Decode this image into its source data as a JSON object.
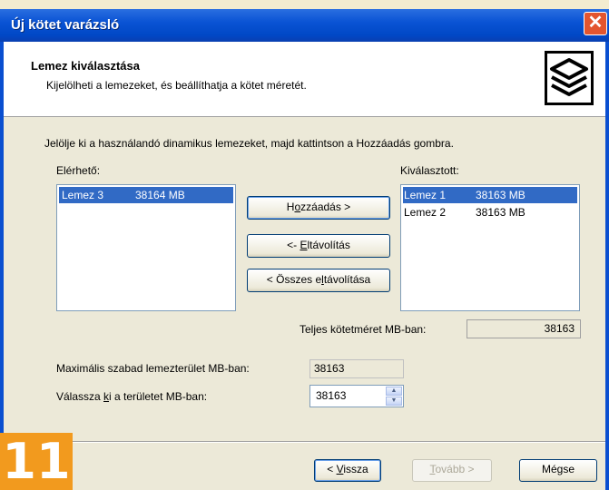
{
  "window": {
    "title": "Új kötet varázsló",
    "close_glyph": "✕"
  },
  "header": {
    "title": "Lemez kiválasztása",
    "subtitle": "Kijelölheti a lemezeket, és beállíthatja a kötet méretét.",
    "icon": "disks-stack-icon"
  },
  "instruction": "Jelölje ki a használandó dinamikus lemezeket, majd kattintson a Hozzáadás gombra.",
  "available": {
    "label": "Elérhető:",
    "items": [
      {
        "name": "Lemez 3",
        "size": "38164 MB",
        "selected": true
      }
    ]
  },
  "selected": {
    "label": "Kiválasztott:",
    "items": [
      {
        "name": "Lemez 1",
        "size": "38163 MB",
        "selected": true
      },
      {
        "name": "Lemez 2",
        "size": "38163 MB",
        "selected": false
      }
    ]
  },
  "buttons": {
    "add_pre": "H",
    "add_u": "o",
    "add_post": "zzáadás >",
    "remove_pre": "<- ",
    "remove_u": "E",
    "remove_post": "ltávolítás",
    "remove_all_pre": "< Összes e",
    "remove_all_u": "l",
    "remove_all_post": "távolítása",
    "back_pre": "< ",
    "back_u": "V",
    "back_post": "issza",
    "next_u": "T",
    "next_post": "ovább >",
    "cancel": "Mégse"
  },
  "total": {
    "label": "Teljes kötetméret MB-ban:",
    "value": "38163"
  },
  "max_free": {
    "label": "Maximális szabad lemezterület MB-ban:",
    "value": "38163"
  },
  "choose": {
    "label_pre": "Válassza ",
    "label_u": "k",
    "label_post": "i a területet MB-ban:",
    "value": "38163"
  },
  "badge": "11",
  "colors": {
    "titlebar": "#0a53d4",
    "selection": "#316ac5",
    "badge": "#f29a1e",
    "close": "#e3552f"
  }
}
